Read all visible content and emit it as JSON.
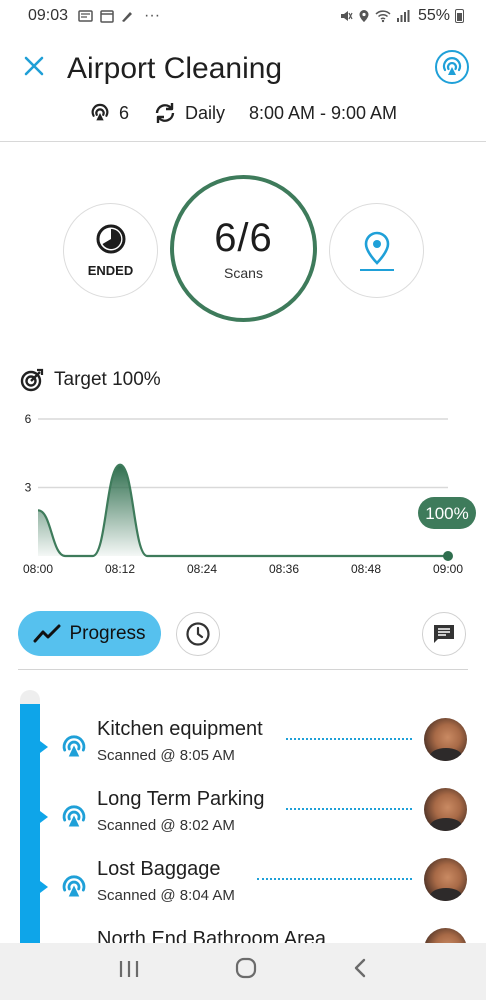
{
  "status_bar": {
    "time": "09:03",
    "more": "···",
    "battery": "55%"
  },
  "header": {
    "title": "Airport Cleaning",
    "checkpoints": "6",
    "frequency": "Daily",
    "time_range": "8:00 AM - 9:00 AM"
  },
  "summary": {
    "status": "ENDED",
    "scans_value": "6/6",
    "scans_label": "Scans"
  },
  "target": {
    "label": "Target 100%"
  },
  "chart_data": {
    "type": "area",
    "x": [
      "08:00",
      "08:04",
      "08:08",
      "08:12",
      "08:16",
      "08:20",
      "08:24",
      "08:36",
      "08:48",
      "09:00"
    ],
    "values": [
      2,
      0,
      0,
      4,
      0,
      0,
      0,
      0,
      0,
      0
    ],
    "x_ticks": [
      "08:00",
      "08:12",
      "08:24",
      "08:36",
      "08:48",
      "09:00"
    ],
    "y_ticks": [
      "6",
      "3"
    ],
    "ylim": [
      0,
      6
    ],
    "end_label": "100%",
    "colors": {
      "fill": "#2f6e4e",
      "line": "#3e7b5b",
      "grid": "#d9d9d9"
    }
  },
  "tabs": {
    "progress": "Progress"
  },
  "items": [
    {
      "title": "Kitchen equipment",
      "sub": "Scanned @ 8:05 AM"
    },
    {
      "title": "Long Term Parking",
      "sub": "Scanned @ 8:02 AM"
    },
    {
      "title": "Lost Baggage",
      "sub": "Scanned @ 8:04 AM"
    },
    {
      "title": "North End Bathroom Area",
      "sub": ""
    }
  ],
  "colors": {
    "accent": "#1fa0d8",
    "progress_bg": "#56c1ee",
    "timeline": "#0ea5e9",
    "ring": "#3e7b5b"
  }
}
